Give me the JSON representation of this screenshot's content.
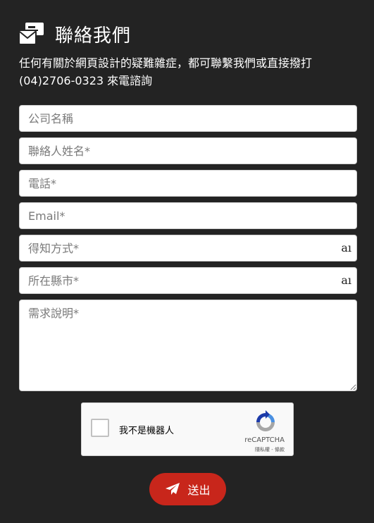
{
  "header": {
    "title": "聯絡我們",
    "icon": "envelope-card-icon",
    "intro": "任何有關於網頁設計的疑難雜症，都可聯繫我們或直接撥打(04)2706-0323 來電諮詢"
  },
  "form": {
    "company_placeholder": "公司名稱",
    "contact_placeholder": "聯絡人姓名*",
    "phone_placeholder": "電話*",
    "email_placeholder": "Email*",
    "contact_method_placeholder": "得知方式*",
    "contact_method_mark": "aı",
    "county_placeholder": "所在縣市*",
    "county_mark": "aı",
    "needs_placeholder": "需求說明*"
  },
  "captcha": {
    "label": "我不是機器人",
    "brand": "reCAPTCHA",
    "links": "隱私權 - 條款",
    "logo_icon": "recaptcha-icon"
  },
  "submit": {
    "label": "送出",
    "icon": "paper-plane-icon",
    "color": "#c8261b"
  },
  "colors": {
    "background": "#232323",
    "text": "#ffffff"
  }
}
